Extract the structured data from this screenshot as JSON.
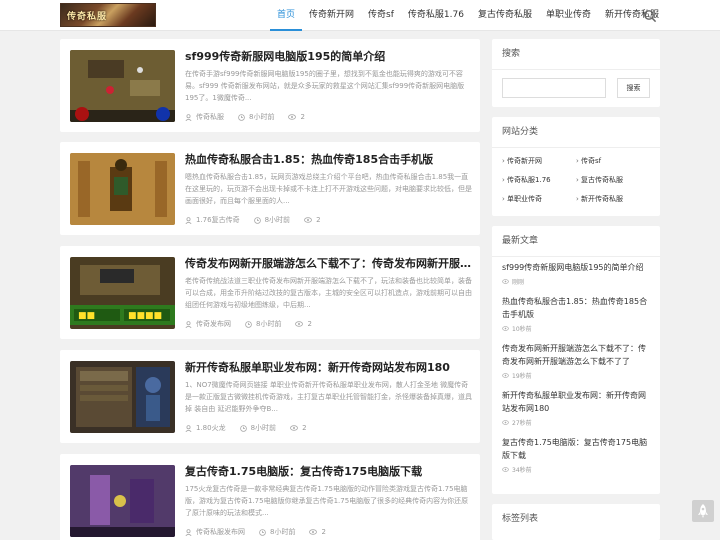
{
  "header": {
    "logo_text": "传奇私服",
    "nav": [
      "首页",
      "传奇新开网",
      "传奇sf",
      "传奇私服1.76",
      "复古传奇私服",
      "单职业传奇",
      "新开传奇私服"
    ]
  },
  "articles": [
    {
      "title": "sf999传奇新服网电脑版195的简单介绍",
      "excerpt": "在传奇手游sf999传奇新服网电脑版195的圈子里，想找到不氪金也能玩得爽的游戏可不容易。sf999 传奇新服发布网站，就是众多玩家的救星这个网站汇集sf999传奇新服网电脑版195了。1微魔传奇...",
      "category": "传奇私服",
      "time": "8小时前",
      "views": "2"
    },
    {
      "title": "热血传奇私服合击1.85：热血传奇185合击手机版",
      "excerpt": "嗯热血传奇私服合击1.85，玩网页游戏总绕主介绍个平台吧，热血传奇私服合击1.85我一直在这里玩的，玩页游不会出现卡掉或不卡连上打不开游戏这些问题，对电脑要求比较低，但是画面很好，而且每个服里面的人...",
      "category": "1.76复古传奇",
      "time": "8小时前",
      "views": "2"
    },
    {
      "title": "传奇发布网新开服端游怎么下载不了：传奇发布网新开服端游...",
      "excerpt": "老传奇传统战法道三职业传奇发布网新开服端游怎么下载不了，玩法和装备也比较简单，装备可以合成，用金币升阶结过改技的复古版本，主城的安全区可以打机造点，游戏前期可以自由组团任何游戏与初级地图练级，中后期...",
      "category": "传奇发布网",
      "time": "8小时前",
      "views": "2"
    },
    {
      "title": "新开传奇私服单职业发布网：新开传奇网站发布网180",
      "excerpt": "1、NO7微魔传奇网页链接 单职业传奇新开传奇私服单职业发布网，散人打金圣地 微魔传奇是一款正版复古微微挂机传奇游戏，主打复古单职业托管智能打金，杀怪爆装备掉真爆，道具掉 装自由 延迟能野外争夺B...",
      "category": "1.80火龙",
      "time": "8小时前",
      "views": "2"
    },
    {
      "title": "复古传奇1.75电脑版：复古传奇175电脑版下载",
      "excerpt": "175火龙复古传奇是一款非常经典复古传奇1.75电脑版的动作冒险类游戏复古传奇1.75电脑版，游戏为复古传奇1.75电脑版你继承复古传奇1.75电脑版了很多的经典传奇内容为你还原了原汁原味的玩法和模式...",
      "category": "传奇私服发布网",
      "time": "8小时前",
      "views": "2"
    }
  ],
  "sidebar": {
    "search_title": "搜索",
    "search_button": "搜索",
    "categories_title": "网站分类",
    "categories": [
      "传奇新开网",
      "传奇sf",
      "传奇私服1.76",
      "复古传奇私服",
      "单职业传奇",
      "新开传奇私服"
    ],
    "recent_title": "最新文章",
    "recent": [
      {
        "title": "sf999传奇新服网电脑版195的简单介绍",
        "date": "刚刚"
      },
      {
        "title": "热血传奇私服合击1.85：热血传奇185合击手机版",
        "date": "10秒前"
      },
      {
        "title": "传奇发布网新开服端游怎么下载不了：传奇发布网新开服端游怎么下载不了了",
        "date": "19秒前"
      },
      {
        "title": "新开传奇私服单职业发布网：新开传奇网站发布网180",
        "date": "27秒前"
      },
      {
        "title": "复古传奇1.75电脑版：复古传奇175电脑版下载",
        "date": "34秒前"
      }
    ],
    "tags_title": "标签列表"
  },
  "colors": {
    "accent": "#2a8fd8",
    "bg": "#f1f1f1"
  }
}
